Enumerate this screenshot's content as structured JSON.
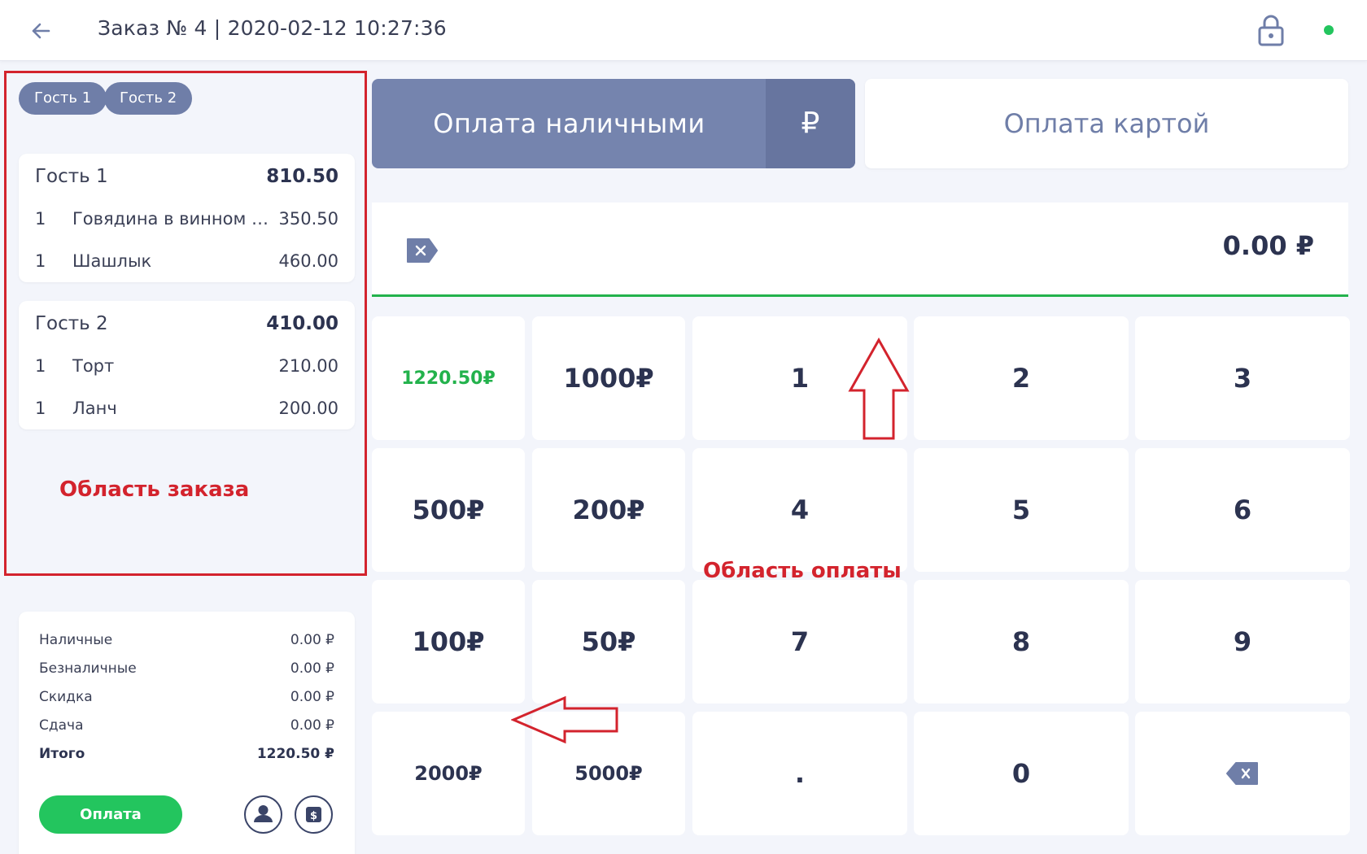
{
  "header": {
    "title": "Заказ № 4 | 2020-02-12 10:27:36"
  },
  "guest_tabs": [
    {
      "label": "Гость 1"
    },
    {
      "label": "Гость 2"
    }
  ],
  "guests": [
    {
      "name": "Гость 1",
      "total": "810.50",
      "items": [
        {
          "qty": "1",
          "name": "Говядина в винном с...",
          "price": "350.50"
        },
        {
          "qty": "1",
          "name": "Шашлык",
          "price": "460.00"
        }
      ]
    },
    {
      "name": "Гость 2",
      "total": "410.00",
      "items": [
        {
          "qty": "1",
          "name": "Торт",
          "price": "210.00"
        },
        {
          "qty": "1",
          "name": "Ланч",
          "price": "200.00"
        }
      ]
    }
  ],
  "annotations": {
    "order_area": "Область заказа",
    "payment_area": "Область оплаты"
  },
  "summary": {
    "rows": [
      {
        "label": "Наличные",
        "value": "0.00 ₽"
      },
      {
        "label": "Безналичные",
        "value": "0.00 ₽"
      },
      {
        "label": "Скидка",
        "value": "0.00 ₽"
      },
      {
        "label": "Сдача",
        "value": "0.00 ₽"
      },
      {
        "label": "Итого",
        "value": "1220.50 ₽"
      }
    ],
    "pay_button": "Оплата"
  },
  "payment": {
    "cash_label": "Оплата наличными",
    "cash_currency": "₽",
    "card_label": "Оплата картой",
    "amount": "0.00  ₽"
  },
  "keypad": {
    "quick_total": "1220.50₽",
    "presets": [
      "1000₽",
      "500₽",
      "200₽",
      "100₽",
      "50₽",
      "2000₽",
      "5000₽"
    ],
    "digits": [
      "1",
      "2",
      "3",
      "4",
      "5",
      "6",
      "7",
      "8",
      "9",
      ".",
      "0"
    ]
  },
  "colors": {
    "accent": "#7584ae",
    "success": "#23c55e",
    "annotation": "#d3232d"
  }
}
